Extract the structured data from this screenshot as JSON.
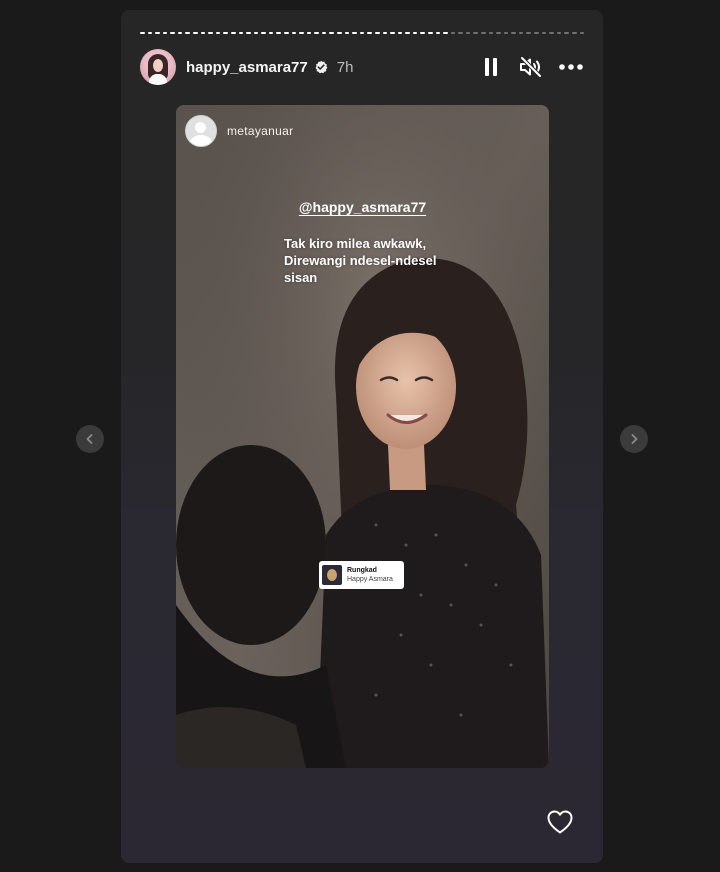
{
  "story": {
    "progress": [
      1,
      1,
      1,
      1,
      1,
      1,
      1,
      1,
      1,
      1,
      1,
      1,
      1,
      1,
      1,
      1,
      1,
      1,
      1,
      1,
      1,
      1,
      1,
      1,
      1,
      1,
      1,
      1,
      1,
      1,
      1,
      1,
      1,
      1,
      1,
      1,
      1,
      1,
      1,
      1,
      1,
      0,
      0,
      0,
      0,
      0,
      0,
      0,
      0,
      0,
      0,
      0,
      0,
      0,
      0,
      0,
      0,
      0,
      0
    ],
    "header": {
      "username": "happy_asmara77",
      "time": "7h",
      "verified": true
    },
    "controls": {
      "pause_icon": "pause-icon",
      "mute_icon": "speaker-muted-icon",
      "more_icon": "more-options-icon"
    },
    "media": {
      "repost_username": "metayanuar",
      "mention": "@happy_asmara77",
      "caption": "Tak kiro milea awkawk,\nDirewangi ndesel-ndesel\nsisan",
      "music_sticker": {
        "title": "Rungkad",
        "artist": "Happy Asmara"
      }
    },
    "like_icon": "heart-icon"
  },
  "navigation": {
    "prev_icon": "chevron-left-icon",
    "next_icon": "chevron-right-icon"
  },
  "colors": {
    "page_background": "#1a1a1a",
    "story_background": "#262626",
    "nav_button": "#3b3b3b",
    "text_primary": "#ffffff",
    "text_secondary": "#bdbdbd",
    "verified_badge": "#ffffff"
  }
}
